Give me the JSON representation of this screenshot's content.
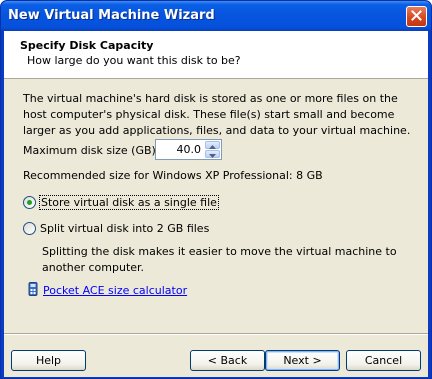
{
  "window": {
    "title": "New Virtual Machine Wizard"
  },
  "header": {
    "title": "Specify Disk Capacity",
    "subtitle": "How large do you want this disk to be?"
  },
  "body": {
    "description": "The virtual machine's hard disk is stored as one or more files on the host computer's physical disk. These file(s) start small and become larger as you add applications, files, and data to your virtual machine.",
    "disk_size_label": "Maximum disk size (GB):",
    "disk_size_value": "40.0",
    "recommendation": "Recommended size for Windows XP Professional: 8 GB",
    "options": [
      {
        "label": "Store virtual disk as a single file",
        "selected": true
      },
      {
        "label": "Split virtual disk into 2 GB files",
        "selected": false
      }
    ],
    "split_description": "Splitting the disk makes it easier to move the virtual machine to another computer.",
    "calculator_link": "Pocket ACE size calculator"
  },
  "buttons": {
    "help": "Help",
    "back": "< Back",
    "next": "Next >",
    "cancel": "Cancel"
  },
  "colors": {
    "titlebar": "#0754de",
    "dialog_bg": "#ece9d8",
    "link": "#0000ff",
    "radio_dot": "#21a121"
  }
}
